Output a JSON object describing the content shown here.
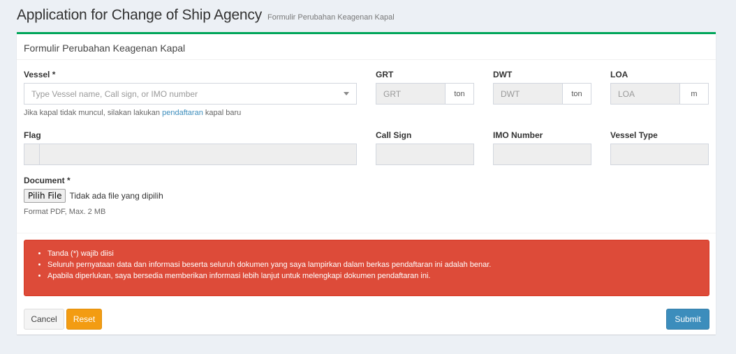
{
  "header": {
    "title": "Application for Change of Ship Agency",
    "subtitle": "Formulir Perubahan Keagenan Kapal"
  },
  "form": {
    "box_title": "Formulir Perubahan Keagenan Kapal",
    "vessel": {
      "label": "Vessel *",
      "placeholder": "Type Vessel name, Call sign, or IMO number",
      "help_prefix": "Jika kapal tidak muncul, silakan lakukan ",
      "help_link": "pendaftaran",
      "help_suffix": " kapal baru"
    },
    "grt": {
      "label": "GRT",
      "placeholder": "GRT",
      "unit": "ton"
    },
    "dwt": {
      "label": "DWT",
      "placeholder": "DWT",
      "unit": "ton"
    },
    "loa": {
      "label": "LOA",
      "placeholder": "LOA",
      "unit": "m"
    },
    "flag": {
      "label": "Flag"
    },
    "call_sign": {
      "label": "Call Sign"
    },
    "imo_number": {
      "label": "IMO Number"
    },
    "vessel_type": {
      "label": "Vessel Type"
    },
    "document": {
      "label": "Document *",
      "button": "Pilih File",
      "file_status": "Tidak ada file yang dipilih",
      "help": "Format PDF, Max. 2 MB"
    },
    "notices": [
      "Tanda (*) wajib diisi",
      "Seluruh pernyataan data dan informasi beserta seluruh dokumen yang saya lampirkan dalam berkas pendaftaran ini adalah benar.",
      "Apabila diperlukan, saya bersedia memberikan informasi lebih lanjut untuk melengkapi dokumen pendaftaran ini."
    ],
    "buttons": {
      "cancel": "Cancel",
      "reset": "Reset",
      "submit": "Submit"
    }
  },
  "colors": {
    "accent_top": "#00a65a",
    "alert": "#dd4b39",
    "reset": "#f39c12",
    "submit": "#3c8dbc",
    "link": "#3c8dbc"
  },
  "icons": {
    "vessel_dropdown": "chevron-down-icon"
  }
}
